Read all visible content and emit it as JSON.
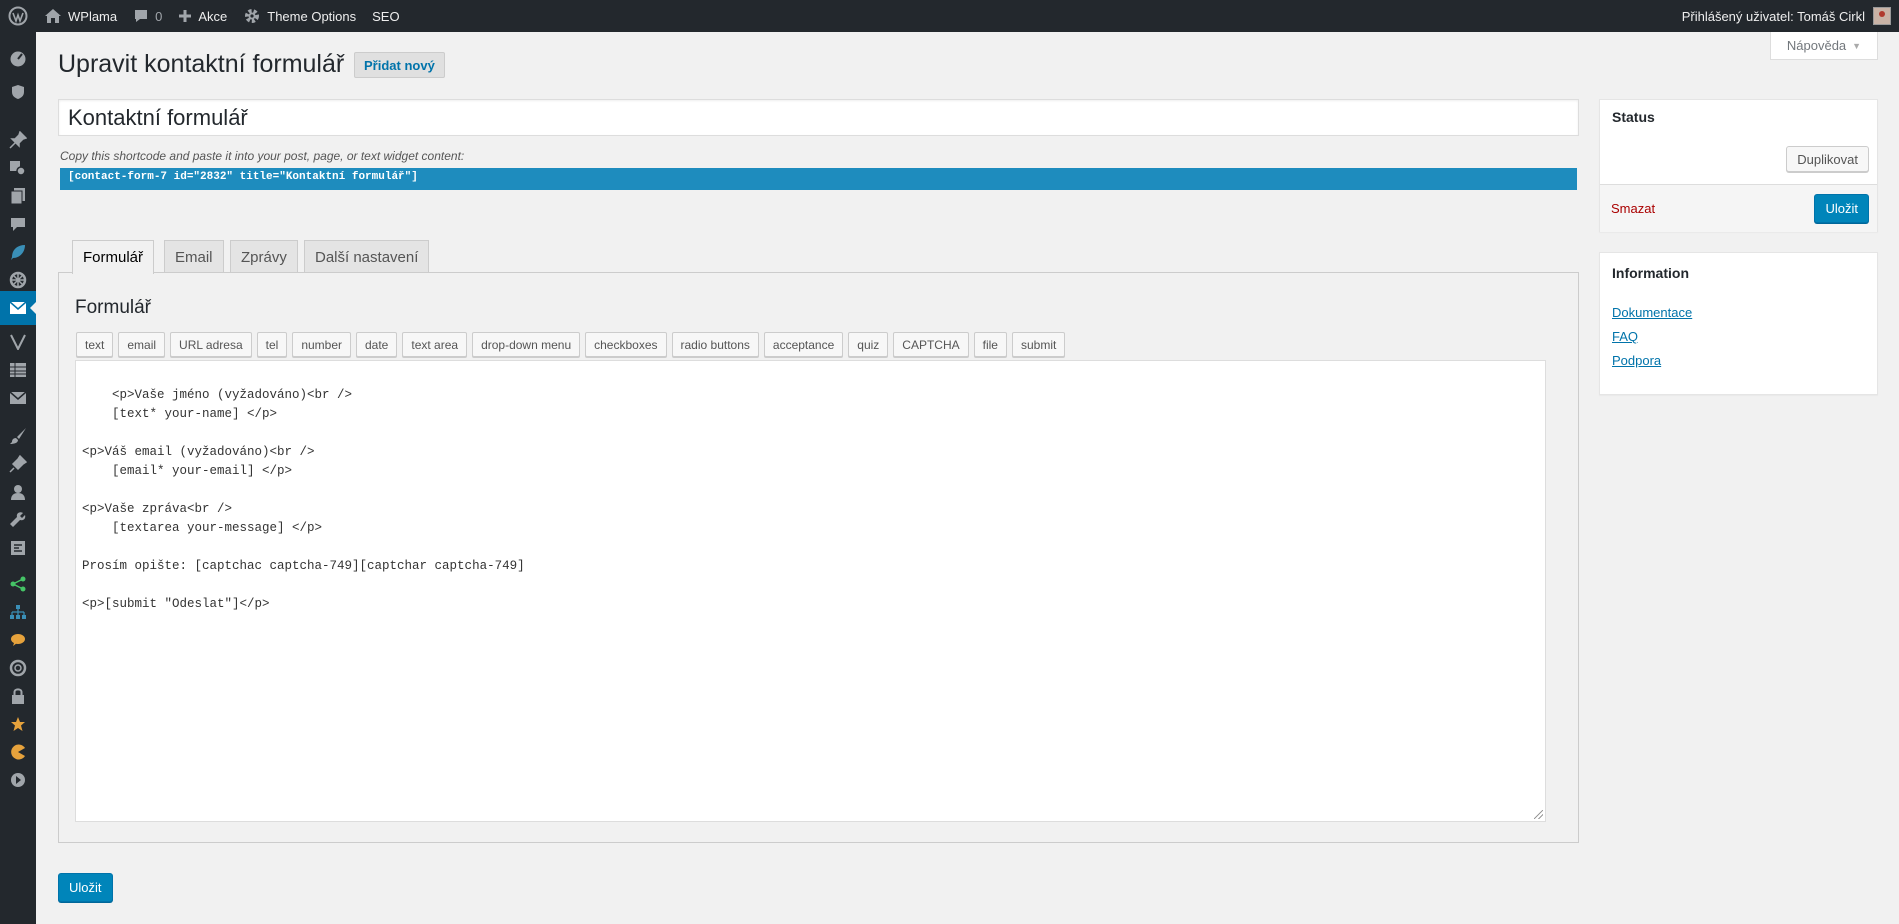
{
  "adminbar": {
    "site_name": "WPlama",
    "comments_count": "0",
    "new_label": "Akce",
    "theme_options": "Theme Options",
    "seo": "SEO",
    "greeting": "Přihlášený uživatel: Tomáš Cirkl"
  },
  "help_tab": "Nápověda",
  "header": {
    "title": "Upravit kontaktní formulář",
    "add_new": "Přidat nový"
  },
  "form_title": "Kontaktní formulář",
  "shortcode": {
    "note": "Copy this shortcode and paste it into your post, page, or text widget content:",
    "code": "[contact-form-7 id=\"2832\" title=\"Kontaktní formulář\"]"
  },
  "tabs": [
    "Formulář",
    "Email",
    "Zprávy",
    "Další nastavení"
  ],
  "form_panel": {
    "heading": "Formulář",
    "tag_buttons": [
      "text",
      "email",
      "URL adresa",
      "tel",
      "number",
      "date",
      "text area",
      "drop-down menu",
      "checkboxes",
      "radio buttons",
      "acceptance",
      "quiz",
      "CAPTCHA",
      "file",
      "submit"
    ],
    "content": "<p>Vaše jméno (vyžadováno)<br />\n    [text* your-name] </p>\n\n<p>Váš email (vyžadováno)<br />\n    [email* your-email] </p>\n\n<p>Vaše zpráva<br />\n    [textarea your-message] </p>\n\nProsím opište: [captchac captcha-749][captchar captcha-749]\n\n<p>[submit \"Odeslat\"]</p>"
  },
  "save_label": "Uložit",
  "status_box": {
    "title": "Status",
    "duplicate": "Duplikovat",
    "delete": "Smazat",
    "save": "Uložit"
  },
  "info_box": {
    "title": "Information",
    "links": [
      "Dokumentace",
      "FAQ",
      "Podpora"
    ]
  },
  "colors": {
    "adminbar": "#23282d",
    "primary_button": "#0085ba",
    "shortcode_bg": "#1e8cbe",
    "delete": "#aa0000"
  }
}
